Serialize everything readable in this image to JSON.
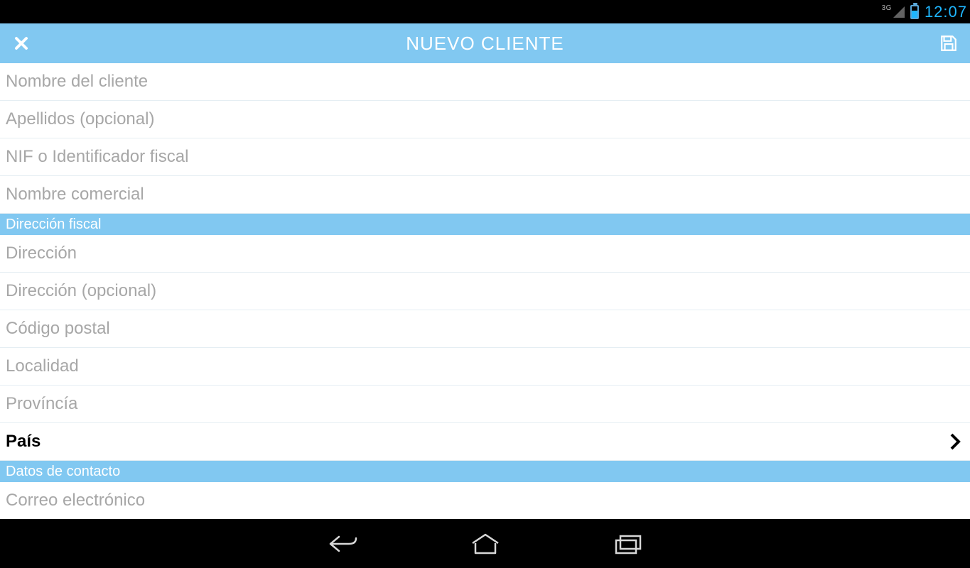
{
  "status_bar": {
    "network_badge": "3G",
    "clock": "12:07"
  },
  "header": {
    "title": "NUEVO CLIENTE"
  },
  "form": {
    "client_name_ph": "Nombre del cliente",
    "surname_ph": "Apellidos (opcional)",
    "nif_ph": "NIF o Identificador fiscal",
    "trade_name_ph": "Nombre comercial"
  },
  "section_address_title": "Dirección fiscal",
  "address": {
    "line1_ph": "Dirección",
    "line2_ph": "Dirección (opcional)",
    "postal_ph": "Código postal",
    "city_ph": "Localidad",
    "province_ph": "Províncía",
    "country_label": "País"
  },
  "section_contact_title": "Datos de contacto",
  "contact": {
    "email_ph": "Correo electrónico"
  }
}
